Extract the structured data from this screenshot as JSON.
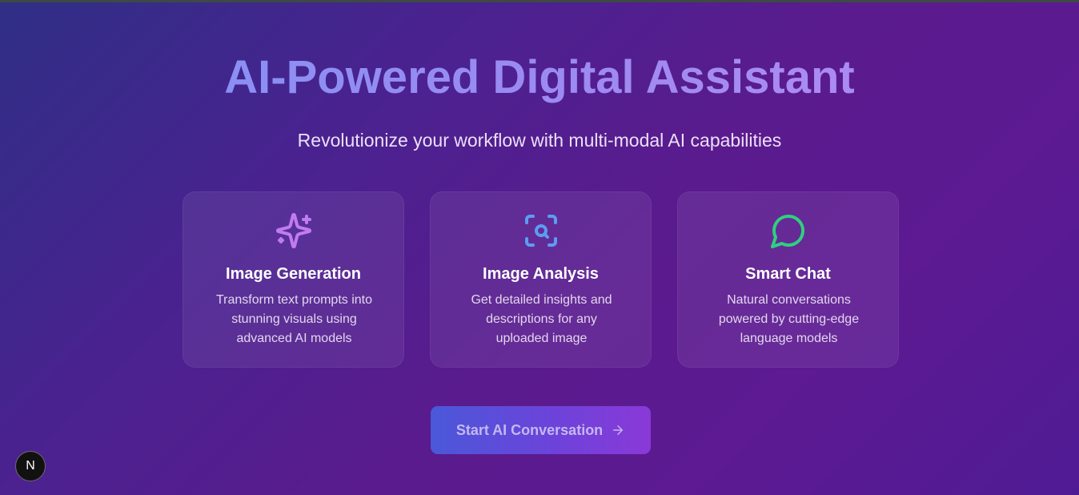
{
  "hero": {
    "title": "AI-Powered Digital Assistant",
    "subtitle": "Revolutionize your workflow with multi-modal AI capabilities"
  },
  "features": [
    {
      "icon": "sparkles-icon",
      "icon_color": "#c17bf0",
      "title": "Image Generation",
      "description": "Transform text prompts into stunning visuals using advanced AI models"
    },
    {
      "icon": "scan-search-icon",
      "icon_color": "#5d9cf3",
      "title": "Image Analysis",
      "description": "Get detailed insights and descriptions for any uploaded image"
    },
    {
      "icon": "message-circle-icon",
      "icon_color": "#2fd07f",
      "title": "Smart Chat",
      "description": "Natural conversations powered by cutting-edge language models"
    }
  ],
  "cta": {
    "label": "Start AI Conversation",
    "icon": "arrow-right-icon"
  },
  "dev_badge": {
    "label": "N"
  },
  "colors": {
    "title_gradient_start": "#7e93f5",
    "title_gradient_end": "#b68cf4",
    "cta_gradient_start": "#4a58d9",
    "cta_gradient_end": "#8a39d8"
  }
}
